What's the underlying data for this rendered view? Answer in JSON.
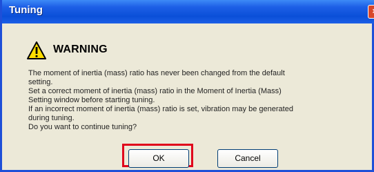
{
  "window": {
    "title": "Tuning"
  },
  "titlebar": {
    "close_label": "×"
  },
  "dialog": {
    "heading": "WARNING",
    "message_lines": [
      "The moment of inertia (mass) ratio has never been changed from the default",
      "setting.",
      "Set a correct moment of inertia (mass) ratio in the Moment of Inertia (Mass)",
      "Setting window before starting tuning.",
      "If an incorrect moment of inertia (mass) ratio is set, vibration may be generated",
      "during tuning.",
      "Do you want to continue tuning?"
    ]
  },
  "buttons": {
    "ok_label": "OK",
    "cancel_label": "Cancel"
  },
  "colors": {
    "titlebar": "#1d5fe6",
    "dialog_bg": "#ece9d8",
    "highlight_border": "#e0001b",
    "warning_icon_fill": "#ffdd00"
  },
  "icons": {
    "warning": "warning-triangle-icon",
    "close": "close-icon"
  }
}
